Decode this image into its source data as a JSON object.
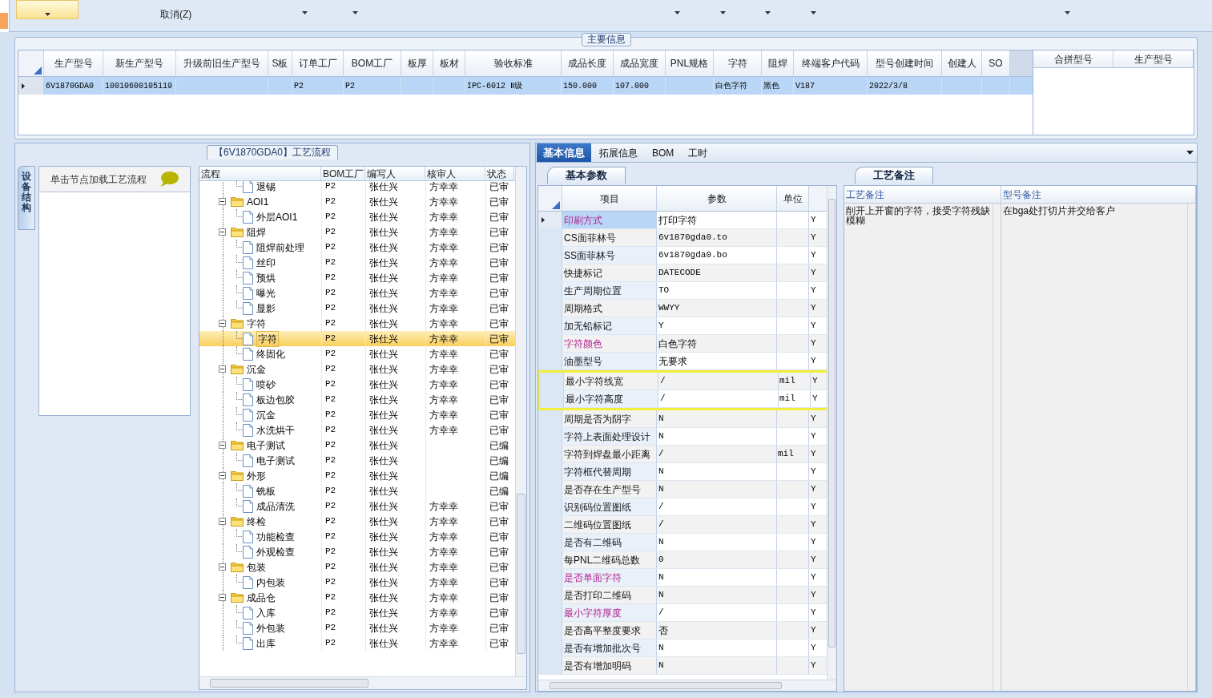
{
  "toolbar": {
    "menu_item": "取消(Z)"
  },
  "main_info": {
    "title": "主要信息",
    "row_selected": true,
    "columns": [
      {
        "header": "生产型号",
        "value": "6V1870GDA0"
      },
      {
        "header": "新生产型号",
        "value": "10010600105119"
      },
      {
        "header": "升级前旧生产型号"
      },
      {
        "header": "S板"
      },
      {
        "header": "订单工厂",
        "value": "P2"
      },
      {
        "header": "BOM工厂",
        "value": "P2"
      },
      {
        "header": "板厚"
      },
      {
        "header": "板材"
      },
      {
        "header": "验收标准",
        "value": "IPC-6012 Ⅱ级"
      },
      {
        "header": "成品长度",
        "value": "150.000"
      },
      {
        "header": "成品宽度",
        "value": "107.000"
      },
      {
        "header": "PNL规格"
      },
      {
        "header": "字符",
        "value": "白色字符"
      },
      {
        "header": "阻焊",
        "value": "黑色"
      },
      {
        "header": "终端客户代码",
        "value": "V187"
      },
      {
        "header": "型号创建时间",
        "value": "2022/3/8"
      },
      {
        "header": "创建人"
      },
      {
        "header": "SO"
      }
    ],
    "side_columns": [
      "合拼型号",
      "生产型号"
    ]
  },
  "flow_panel": {
    "title": "【6V1870GDA0】工艺流程",
    "side_tab": "设备结构",
    "hint": "单击节点加载工艺流程",
    "columns": [
      "流程",
      "BOM工厂",
      "编写人",
      "核审人",
      "状态"
    ],
    "tree": [
      {
        "kind": "partial",
        "children": [
          {
            "label": "退锡",
            "bom": "P2",
            "writer": "张仕兴",
            "reviewer": "方幸幸",
            "status": "已审",
            "selected": false
          }
        ]
      },
      {
        "kind": "folder",
        "label": "AOI1",
        "bom": "P2",
        "writer": "张仕兴",
        "reviewer": "方幸幸",
        "status": "已审",
        "selected": false,
        "expanded": true,
        "children": [
          {
            "label": "外层AOI1",
            "bom": "P2",
            "writer": "张仕兴",
            "reviewer": "方幸幸",
            "status": "已审",
            "selected": false
          }
        ]
      },
      {
        "kind": "folder",
        "label": "阻焊",
        "bom": "P2",
        "writer": "张仕兴",
        "reviewer": "方幸幸",
        "status": "已审",
        "selected": false,
        "expanded": true,
        "children": [
          {
            "label": "阻焊前处理",
            "bom": "P2",
            "writer": "张仕兴",
            "reviewer": "方幸幸",
            "status": "已审",
            "selected": false
          },
          {
            "label": "丝印",
            "bom": "P2",
            "writer": "张仕兴",
            "reviewer": "方幸幸",
            "status": "已审",
            "selected": false
          },
          {
            "label": "预烘",
            "bom": "P2",
            "writer": "张仕兴",
            "reviewer": "方幸幸",
            "status": "已审",
            "selected": false
          },
          {
            "label": "曝光",
            "bom": "P2",
            "writer": "张仕兴",
            "reviewer": "方幸幸",
            "status": "已审",
            "selected": false
          },
          {
            "label": "显影",
            "bom": "P2",
            "writer": "张仕兴",
            "reviewer": "方幸幸",
            "status": "已审",
            "selected": false
          }
        ]
      },
      {
        "kind": "folder",
        "label": "字符",
        "bom": "P2",
        "writer": "张仕兴",
        "reviewer": "方幸幸",
        "status": "已审",
        "selected": false,
        "expanded": true,
        "children": [
          {
            "label": "字符",
            "bom": "P2",
            "writer": "张仕兴",
            "reviewer": "方幸幸",
            "status": "已审",
            "selected": true
          },
          {
            "label": "终固化",
            "bom": "P2",
            "writer": "张仕兴",
            "reviewer": "方幸幸",
            "status": "已审",
            "selected": false
          }
        ]
      },
      {
        "kind": "folder",
        "label": "沉金",
        "bom": "P2",
        "writer": "张仕兴",
        "reviewer": "方幸幸",
        "status": "已审",
        "selected": false,
        "expanded": true,
        "children": [
          {
            "label": "喷砂",
            "bom": "P2",
            "writer": "张仕兴",
            "reviewer": "方幸幸",
            "status": "已审",
            "selected": false
          },
          {
            "label": "板边包胶",
            "bom": "P2",
            "writer": "张仕兴",
            "reviewer": "方幸幸",
            "status": "已审",
            "selected": false
          },
          {
            "label": "沉金",
            "bom": "P2",
            "writer": "张仕兴",
            "reviewer": "方幸幸",
            "status": "已审",
            "selected": false
          },
          {
            "label": "水洗烘干",
            "bom": "P2",
            "writer": "张仕兴",
            "reviewer": "方幸幸",
            "status": "已审",
            "selected": false
          }
        ]
      },
      {
        "kind": "folder",
        "label": "电子测试",
        "bom": "P2",
        "writer": "张仕兴",
        "status": "已编",
        "selected": false,
        "expanded": true,
        "children": [
          {
            "label": "电子测试",
            "bom": "P2",
            "writer": "张仕兴",
            "status": "已编",
            "selected": false
          }
        ]
      },
      {
        "kind": "folder",
        "label": "外形",
        "bom": "P2",
        "writer": "张仕兴",
        "status": "已编",
        "selected": false,
        "expanded": true,
        "children": [
          {
            "label": "铣板",
            "bom": "P2",
            "writer": "张仕兴",
            "status": "已编",
            "selected": false
          },
          {
            "label": "成品清洗",
            "bom": "P2",
            "writer": "张仕兴",
            "reviewer": "方幸幸",
            "status": "已审",
            "selected": false
          }
        ]
      },
      {
        "kind": "folder",
        "label": "终检",
        "bom": "P2",
        "writer": "张仕兴",
        "reviewer": "方幸幸",
        "status": "已审",
        "selected": false,
        "expanded": true,
        "children": [
          {
            "label": "功能检查",
            "bom": "P2",
            "writer": "张仕兴",
            "reviewer": "方幸幸",
            "status": "已审",
            "selected": false
          },
          {
            "label": "外观检查",
            "bom": "P2",
            "writer": "张仕兴",
            "reviewer": "方幸幸",
            "status": "已审",
            "selected": false
          }
        ]
      },
      {
        "kind": "folder",
        "label": "包装",
        "bom": "P2",
        "writer": "张仕兴",
        "reviewer": "方幸幸",
        "status": "已审",
        "selected": false,
        "expanded": true,
        "children": [
          {
            "label": "内包装",
            "bom": "P2",
            "writer": "张仕兴",
            "reviewer": "方幸幸",
            "status": "已审",
            "selected": false
          }
        ]
      },
      {
        "kind": "folder",
        "label": "成品仓",
        "bom": "P2",
        "writer": "张仕兴",
        "reviewer": "方幸幸",
        "status": "已审",
        "selected": false,
        "expanded": true,
        "children": [
          {
            "label": "入库",
            "bom": "P2",
            "writer": "张仕兴",
            "reviewer": "方幸幸",
            "status": "已审",
            "selected": false
          },
          {
            "label": "外包装",
            "bom": "P2",
            "writer": "张仕兴",
            "reviewer": "方幸幸",
            "status": "已审",
            "selected": false
          },
          {
            "label": "出库",
            "bom": "P2",
            "writer": "张仕兴",
            "reviewer": "方幸幸",
            "status": "已审",
            "selected": false
          }
        ]
      }
    ]
  },
  "detail_tabs": [
    {
      "label": "基本信息",
      "selected": true
    },
    {
      "label": "拓展信息",
      "selected": false
    },
    {
      "label": "BOM",
      "selected": false
    },
    {
      "label": "工时",
      "selected": false
    }
  ],
  "params": {
    "tab": "基本参数",
    "columns": [
      "项目",
      "参数",
      "单位"
    ],
    "rows": [
      {
        "item": "印刷方式",
        "value": "打印字符",
        "flag": "Y",
        "highlighted": true,
        "selected": true
      },
      {
        "item": "CS面菲林号",
        "value": "6v1870gda0.to",
        "flag": "Y",
        "highlighted": false,
        "selected": false
      },
      {
        "item": "SS面菲林号",
        "value": "6v1870gda0.bo",
        "flag": "Y",
        "highlighted": false,
        "selected": false
      },
      {
        "item": "快捷标记",
        "value": "DATECODE",
        "flag": "Y",
        "highlighted": false,
        "selected": false
      },
      {
        "item": "生产周期位置",
        "value": "TO",
        "flag": "Y",
        "highlighted": false,
        "selected": false
      },
      {
        "item": "周期格式",
        "value": "WWYY",
        "flag": "Y",
        "highlighted": false,
        "selected": false
      },
      {
        "item": "加无铅标记",
        "value": "Y",
        "flag": "Y",
        "highlighted": false,
        "selected": false
      },
      {
        "item": "字符颜色",
        "value": "白色字符",
        "flag": "Y",
        "highlighted": true,
        "selected": false
      },
      {
        "item": "油墨型号",
        "value": "无要求",
        "flag": "Y",
        "highlighted": false,
        "selected": false
      },
      {
        "item": "最小字符线宽",
        "value": "/",
        "unit": "mil",
        "flag": "Y",
        "highlighted": false,
        "selected": false,
        "marked": true
      },
      {
        "item": "最小字符高度",
        "value": "/",
        "unit": "mil",
        "flag": "Y",
        "highlighted": false,
        "selected": false,
        "marked": true
      },
      {
        "item": "周期是否为阴字",
        "value": "N",
        "flag": "Y",
        "highlighted": false,
        "selected": false
      },
      {
        "item": "字符上表面处理设计",
        "value": "N",
        "flag": "Y",
        "highlighted": false,
        "selected": false
      },
      {
        "item": "字符到焊盘最小距离",
        "value": "/",
        "unit": "mil",
        "flag": "Y",
        "highlighted": false,
        "selected": false
      },
      {
        "item": "字符框代替周期",
        "value": "N",
        "flag": "Y",
        "highlighted": false,
        "selected": false
      },
      {
        "item": "是否存在生产型号",
        "value": "N",
        "flag": "Y",
        "highlighted": false,
        "selected": false
      },
      {
        "item": "识别码位置图纸",
        "value": "/",
        "flag": "Y",
        "highlighted": false,
        "selected": false
      },
      {
        "item": "二维码位置图纸",
        "value": "/",
        "flag": "Y",
        "highlighted": false,
        "selected": false
      },
      {
        "item": "是否有二维码",
        "value": "N",
        "flag": "Y",
        "highlighted": false,
        "selected": false
      },
      {
        "item": "每PNL二维码总数",
        "value": "0",
        "flag": "Y",
        "highlighted": false,
        "selected": false
      },
      {
        "item": "是否单面字符",
        "value": "N",
        "flag": "Y",
        "highlighted": true,
        "selected": false
      },
      {
        "item": "是否打印二维码",
        "value": "N",
        "flag": "Y",
        "highlighted": false,
        "selected": false
      },
      {
        "item": "最小字符厚度",
        "value": "/",
        "flag": "Y",
        "highlighted": true,
        "selected": false
      },
      {
        "item": "是否高平整度要求",
        "value": "否",
        "flag": "Y",
        "highlighted": false,
        "selected": false
      },
      {
        "item": "是否有增加批次号",
        "value": "N",
        "flag": "Y",
        "highlighted": false,
        "selected": false
      },
      {
        "item": "是否有增加明码",
        "value": "N",
        "flag": "Y",
        "highlighted": false,
        "selected": false
      }
    ]
  },
  "remarks": {
    "tab": "工艺备注",
    "columns": [
      {
        "header": "工艺备注",
        "text": "削开上开窗的字符，接受字符残缺模糊"
      },
      {
        "header": "型号备注",
        "text": "在bga处打切片并交给客户"
      }
    ]
  }
}
